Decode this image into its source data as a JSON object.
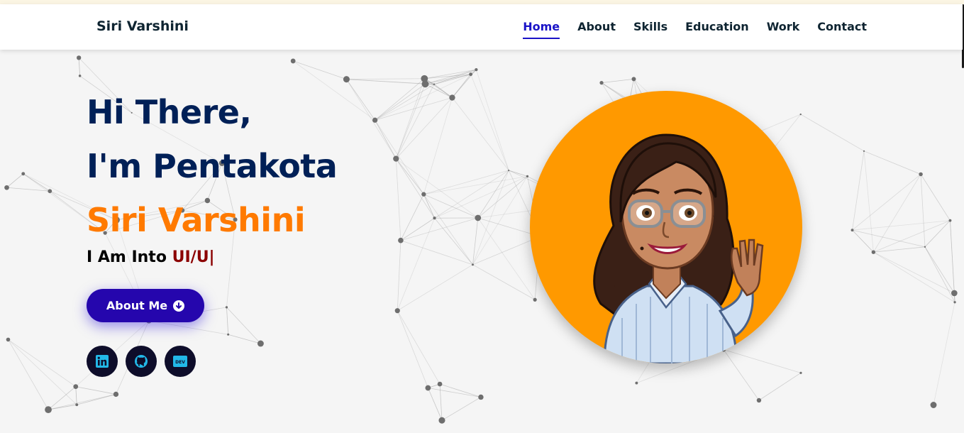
{
  "brand": "Siri Varshini",
  "nav": {
    "items": [
      "Home",
      "About",
      "Skills",
      "Education",
      "Work",
      "Contact"
    ],
    "active": "Home"
  },
  "hero": {
    "line1": "Hi There,",
    "line2": "I'm Pentakota",
    "name": "Siri Varshini",
    "into_prefix": "I Am Into",
    "into_role": "UI/U|"
  },
  "button": {
    "label": "About Me",
    "icon": "arrow-down-circle-icon"
  },
  "socials": [
    {
      "name": "linkedin-icon"
    },
    {
      "name": "github-icon"
    },
    {
      "name": "dev-icon",
      "text": "DEV"
    }
  ],
  "colors": {
    "navy": "#002057",
    "orange": "#ff7a00",
    "role": "#8b0000",
    "button": "#2506ad",
    "avatar_bg": "#ff9900",
    "active_nav": "#1a13c7"
  }
}
